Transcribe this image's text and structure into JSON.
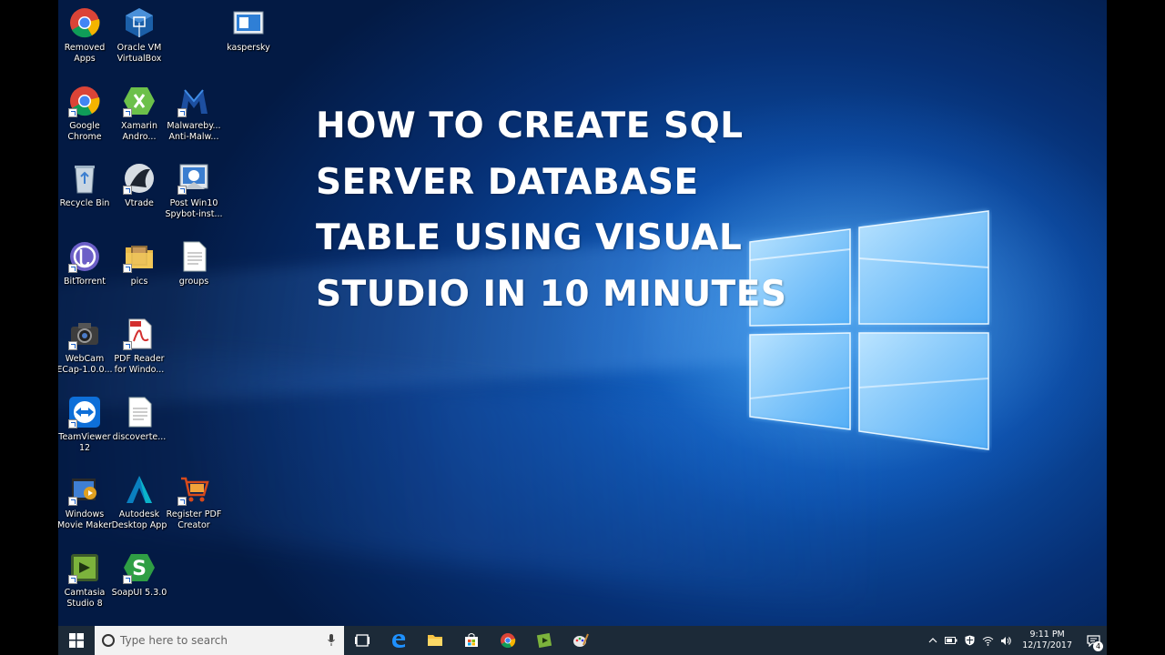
{
  "title_lines": [
    "HOW TO CREATE SQL",
    "SERVER DATABASE",
    "TABLE USING VISUAL",
    "STUDIO IN 10 MINUTES"
  ],
  "desktop_icons": [
    {
      "label": "Removed\nApps",
      "icon": "chrome-icon"
    },
    {
      "label": "Oracle VM\nVirtualBox",
      "icon": "virtualbox-icon"
    },
    {
      "label": "kaspersky",
      "icon": "kaspersky-icon"
    },
    {
      "label": "Google\nChrome",
      "icon": "chrome-icon"
    },
    {
      "label": "Xamarin\nAndro...",
      "icon": "xamarin-icon"
    },
    {
      "label": "Malwareby...\nAnti-Malw...",
      "icon": "malwarebytes-icon"
    },
    {
      "label": "Recycle Bin",
      "icon": "recycle-bin-icon"
    },
    {
      "label": "Vtrade",
      "icon": "vtrade-icon"
    },
    {
      "label": "Post Win10\nSpybot-inst...",
      "icon": "spybot-icon"
    },
    {
      "label": "BitTorrent",
      "icon": "bittorrent-icon"
    },
    {
      "label": "pics",
      "icon": "folder-icon"
    },
    {
      "label": "groups",
      "icon": "document-icon"
    },
    {
      "label": "WebCam\nECap-1.0.0...",
      "icon": "webcam-icon"
    },
    {
      "label": "PDF Reader\nfor Windo...",
      "icon": "pdf-icon"
    },
    {
      "label": "TeamViewer\n12",
      "icon": "teamviewer-icon"
    },
    {
      "label": "discoverte...",
      "icon": "document-icon"
    },
    {
      "label": "Windows\nMovie Maker",
      "icon": "movie-maker-icon"
    },
    {
      "label": "Autodesk\nDesktop App",
      "icon": "autodesk-icon"
    },
    {
      "label": "Register PDF\nCreator",
      "icon": "cart-icon"
    },
    {
      "label": "Camtasia\nStudio 8",
      "icon": "camtasia-icon"
    },
    {
      "label": "SoapUI 5.3.0",
      "icon": "soapui-icon"
    }
  ],
  "taskbar": {
    "search_placeholder": "Type here to search",
    "time": "9:11 PM",
    "date": "12/17/2017",
    "notification_count": "4"
  }
}
